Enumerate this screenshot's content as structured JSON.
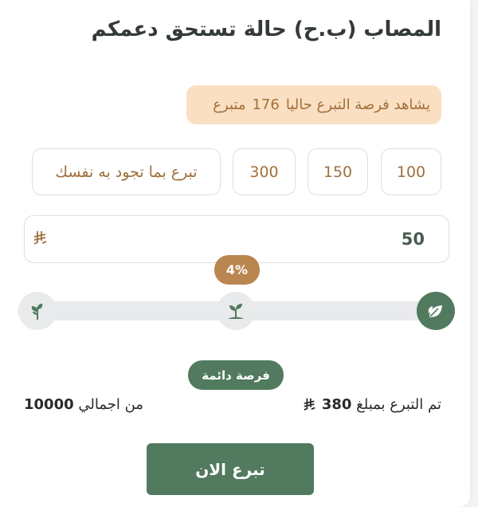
{
  "card": {
    "title": "المصاب (ب.ح) حالة تستحق دعمكم",
    "watch_prefix": "يشاهد فرصة التبرع حاليا",
    "watch_count": "176",
    "watch_suffix": "متبرع"
  },
  "amounts": [
    "100",
    "150",
    "300"
  ],
  "custom_amount_placeholder": "تبرع بما تجود به نفسك",
  "custom_input": {
    "value": "50",
    "currency": "⃁"
  },
  "progress": {
    "percent_label": "4%",
    "percent_value": 4,
    "stage_icons": [
      "seedling-sprout-icon",
      "plant-icon",
      "leaves-icon"
    ]
  },
  "permanent_badge": "فرصة دائمة",
  "stats": {
    "donated_prefix": "تم التبرع بمبلغ",
    "donated_amount": "380",
    "total_prefix": "من اجمالي",
    "total_amount": "10000"
  },
  "donate_button": "تبرع الان",
  "colors": {
    "green": "#517a5e",
    "accent": "#b98650",
    "badge_bg": "#fbdfc2"
  }
}
